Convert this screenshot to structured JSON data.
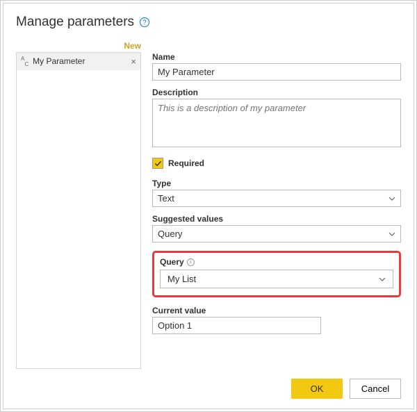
{
  "dialog": {
    "title": "Manage parameters"
  },
  "sidebar": {
    "new_link": "New",
    "items": [
      {
        "glyph": "ABC",
        "label": "My Parameter"
      }
    ]
  },
  "form": {
    "name_label": "Name",
    "name_value": "My Parameter",
    "description_label": "Description",
    "description_placeholder": "This is a description of my parameter",
    "required_label": "Required",
    "required_checked": true,
    "type_label": "Type",
    "type_value": "Text",
    "suggested_label": "Suggested values",
    "suggested_value": "Query",
    "query_label": "Query",
    "query_value": "My List",
    "current_label": "Current value",
    "current_value": "Option 1"
  },
  "footer": {
    "ok": "OK",
    "cancel": "Cancel"
  }
}
